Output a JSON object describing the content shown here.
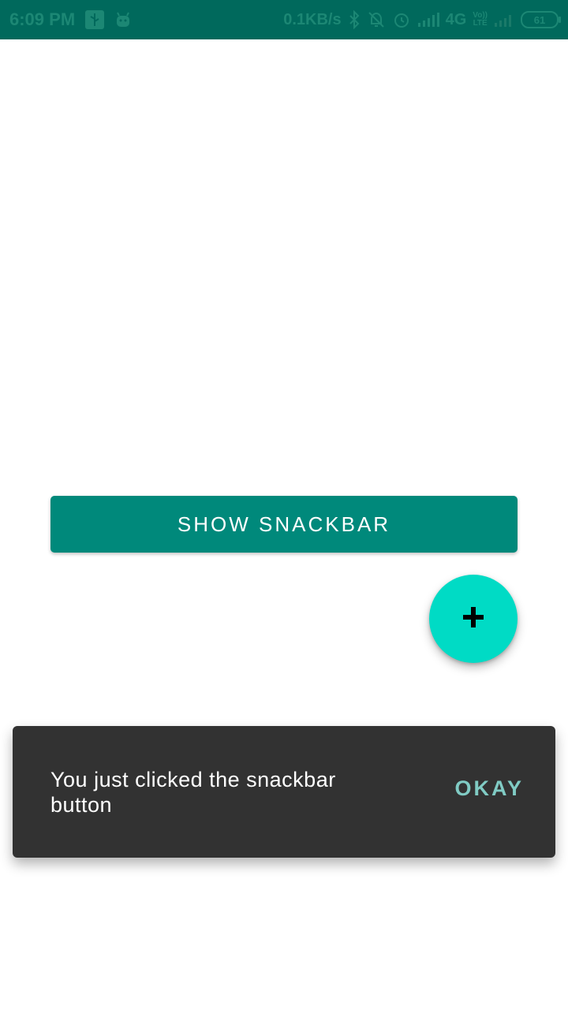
{
  "status_bar": {
    "time": "6:09 PM",
    "net_speed": "0.1KB/s",
    "network": "4G",
    "network_suffix": "+",
    "volte_top": "Vo))",
    "volte_bottom": "LTE",
    "battery": "61",
    "icons": [
      "usb-icon",
      "android-icon",
      "bluetooth-icon",
      "notifications-off-icon",
      "alarm-icon",
      "signal-icon",
      "signal-weak-icon",
      "battery-icon"
    ]
  },
  "main": {
    "show_button_label": "SHOW SNACKBAR",
    "fab_icon": "add-icon"
  },
  "snackbar": {
    "message": "You just clicked the snackbar button",
    "action_label": "OKAY"
  },
  "colors": {
    "status_bar": "#00695c",
    "primary_button": "#00897b",
    "fab": "#00dbc5",
    "snackbar_bg": "#323232",
    "snackbar_action": "#80cbc4"
  }
}
